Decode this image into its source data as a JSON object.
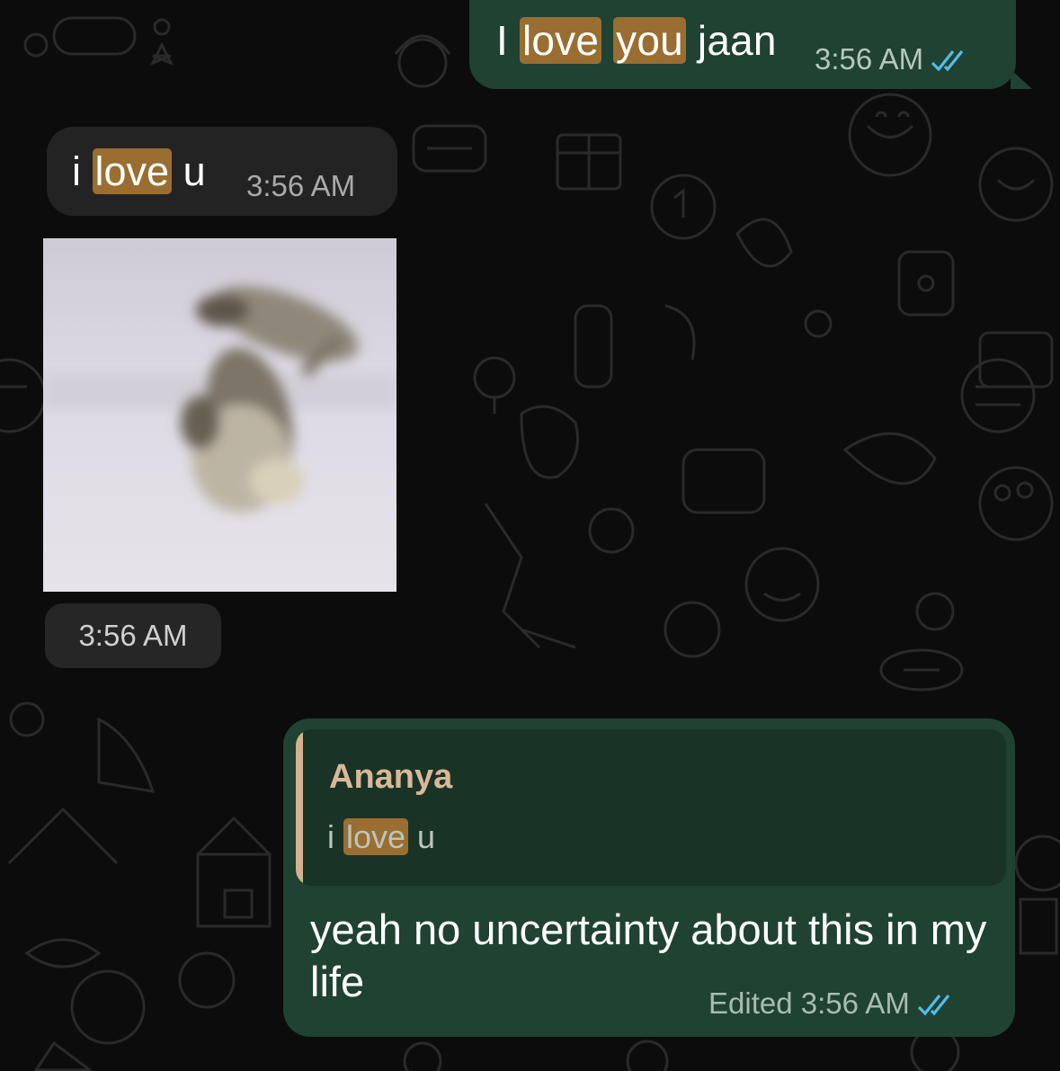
{
  "messages": [
    {
      "direction": "outgoing",
      "text_parts": [
        "I ",
        "love",
        " ",
        "you",
        " jaan"
      ],
      "highlighted_word": "love",
      "highlighted_word_2": "you",
      "time": "3:56 AM",
      "status_icon": "double-check-read-icon"
    },
    {
      "direction": "incoming",
      "text_parts": [
        "i ",
        "love",
        " u"
      ],
      "time": "3:56 AM"
    },
    {
      "direction": "incoming",
      "type": "photo",
      "photo_description_icon": "image-thumbnail",
      "time": "3:56 AM"
    },
    {
      "direction": "outgoing",
      "reply_to": {
        "author": "Ananya",
        "text_parts": [
          "i ",
          "love",
          " u"
        ]
      },
      "text": "yeah no uncertainty about this in my life",
      "edited_label": "Edited",
      "time": "3:56 AM",
      "status_icon": "double-check-read-icon"
    }
  ],
  "colors": {
    "background": "#0c0c0c",
    "outgoing_bubble": "#1f4232",
    "incoming_bubble": "#232323",
    "search_highlight": "#9a6e30",
    "read_ticks": "#53bdeb",
    "quote_bar": "#d4b190"
  }
}
